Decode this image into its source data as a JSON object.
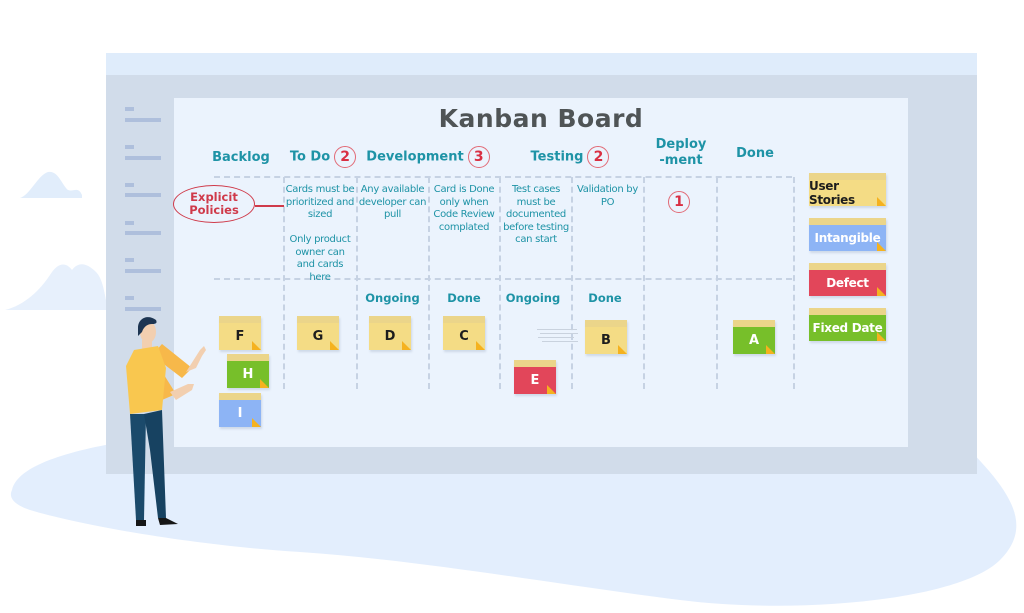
{
  "board": {
    "title": "Kanban Board",
    "explicit_policies_label": "Explicit Policies",
    "columns": [
      {
        "name": "Backlog",
        "wip_limit": null
      },
      {
        "name": "To Do",
        "wip_limit": "2"
      },
      {
        "name": "Development",
        "wip_limit": "3"
      },
      {
        "name": "Testing",
        "wip_limit": "2"
      },
      {
        "name": "Deploy-ment",
        "wip_limit": "1"
      },
      {
        "name": "Done",
        "wip_limit": null
      }
    ],
    "sub_columns": {
      "development": [
        "Ongoing",
        "Done"
      ],
      "testing": [
        "Ongoing",
        "Done"
      ]
    },
    "policies": {
      "todo": [
        "Cards must be prioritized and sized",
        "Only product owner can and cards here"
      ],
      "development_ongoing": "Any available developer can pull",
      "development_done": "Card is Done only when Code Review complated",
      "testing_ongoing": "Test cases must be documented before testing can start",
      "testing_done": "Validation by PO"
    },
    "cards": [
      {
        "id": "F",
        "column": "Backlog",
        "type": "User Stories",
        "color": "#f4dc85"
      },
      {
        "id": "H",
        "column": "Backlog",
        "type": "Fixed Date",
        "color": "#77bf2a"
      },
      {
        "id": "I",
        "column": "Backlog",
        "type": "Intangible",
        "color": "#8db4f5"
      },
      {
        "id": "G",
        "column": "To Do",
        "type": "User Stories",
        "color": "#f4dc85"
      },
      {
        "id": "D",
        "column": "Development / Ongoing",
        "type": "User Stories",
        "color": "#f4dc85"
      },
      {
        "id": "C",
        "column": "Development / Done",
        "type": "User Stories",
        "color": "#f4dc85"
      },
      {
        "id": "E",
        "column": "Testing / Ongoing",
        "type": "Defect",
        "color": "#e2465a"
      },
      {
        "id": "B",
        "column": "Testing / Done",
        "type": "User Stories",
        "color": "#f4dc85"
      },
      {
        "id": "A",
        "column": "Done",
        "type": "Fixed Date",
        "color": "#77bf2a"
      }
    ]
  },
  "legend": [
    {
      "label": "User Stories",
      "color": "#f4dc85"
    },
    {
      "label": "Intangible",
      "color": "#8db4f5"
    },
    {
      "label": "Defect",
      "color": "#e2465a"
    },
    {
      "label": "Fixed Date",
      "color": "#77bf2a"
    }
  ],
  "colors": {
    "heading_teal": "#1e93a6",
    "wip_red": "#d92f43",
    "title_gray": "#4f5456"
  }
}
